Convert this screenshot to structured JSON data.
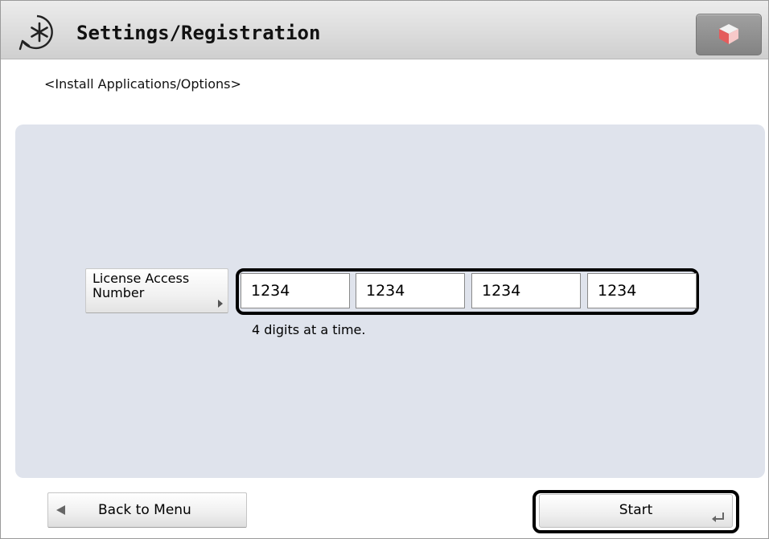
{
  "header": {
    "title": "Settings/Registration",
    "title_icon": "settings-asterisk-icon",
    "corner_icon": "cube-icon"
  },
  "page": {
    "subtitle": "<Install Applications/Options>"
  },
  "license": {
    "label": "License Access Number",
    "digits": [
      "1234",
      "1234",
      "1234",
      "1234"
    ],
    "hint": "4 digits at a time."
  },
  "footer": {
    "back_label": "Back to Menu",
    "start_label": "Start"
  },
  "colors": {
    "panel": "#dfe3ec",
    "titlebar": "#dcdcdc",
    "highlight_outline": "#000000"
  }
}
